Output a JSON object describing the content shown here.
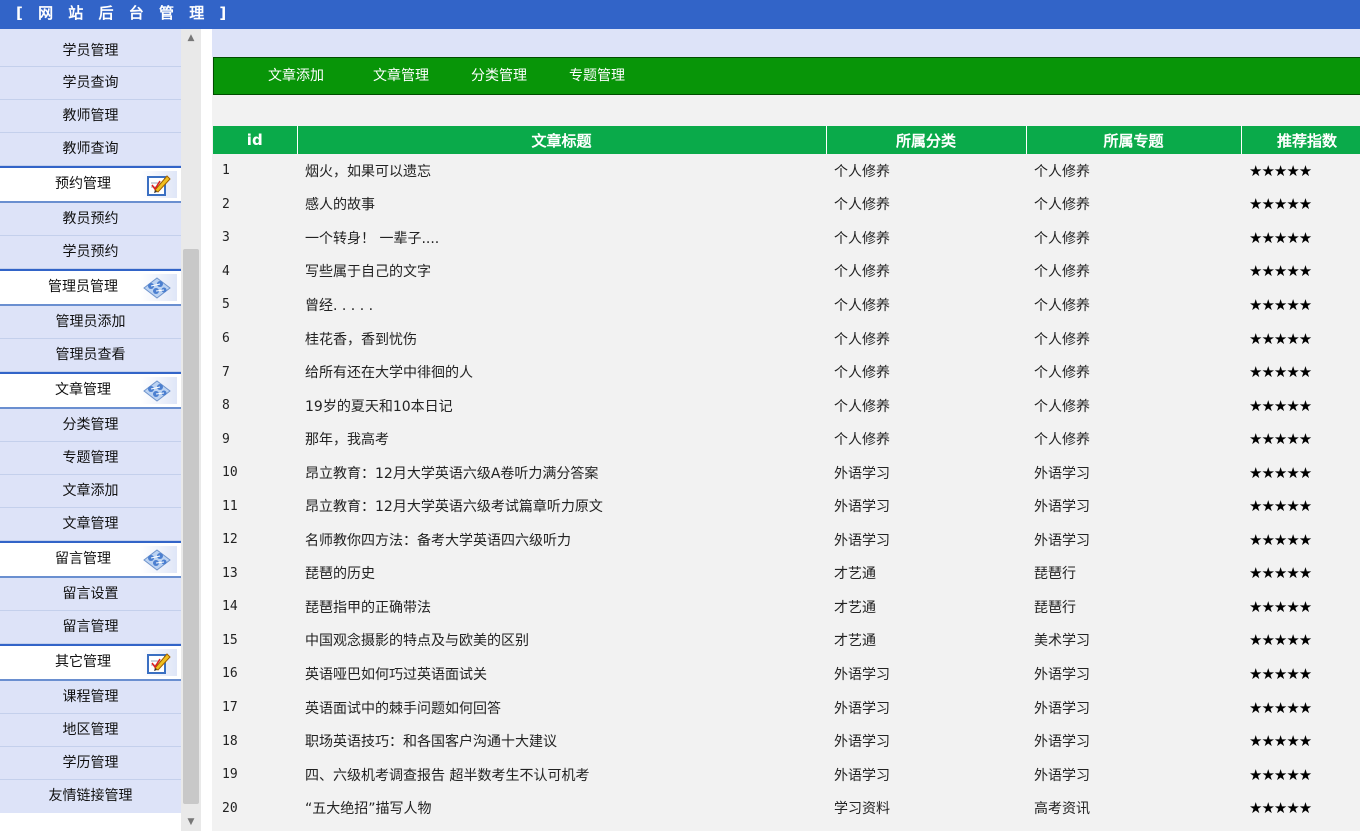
{
  "header": {
    "title": "[ 网 站 后 台 管 理 ]"
  },
  "sidebar": {
    "menu": [
      {
        "kind": "item",
        "label": "学员管理",
        "first": true
      },
      {
        "kind": "item",
        "label": "学员查询"
      },
      {
        "kind": "item",
        "label": "教师管理"
      },
      {
        "kind": "item",
        "label": "教师查询"
      },
      {
        "kind": "group",
        "label": "预约管理",
        "icon": "edit-icon"
      },
      {
        "kind": "item",
        "label": "教员预约"
      },
      {
        "kind": "item",
        "label": "学员预约"
      },
      {
        "kind": "group",
        "label": "管理员管理",
        "icon": "network-icon"
      },
      {
        "kind": "item",
        "label": "管理员添加"
      },
      {
        "kind": "item",
        "label": "管理员查看"
      },
      {
        "kind": "group",
        "label": "文章管理",
        "icon": "network-icon"
      },
      {
        "kind": "item",
        "label": "分类管理"
      },
      {
        "kind": "item",
        "label": "专题管理"
      },
      {
        "kind": "item",
        "label": "文章添加"
      },
      {
        "kind": "item",
        "label": "文章管理"
      },
      {
        "kind": "group",
        "label": "留言管理",
        "icon": "network-icon"
      },
      {
        "kind": "item",
        "label": "留言设置"
      },
      {
        "kind": "item",
        "label": "留言管理"
      },
      {
        "kind": "group",
        "label": "其它管理",
        "icon": "edit-icon"
      },
      {
        "kind": "item",
        "label": "课程管理"
      },
      {
        "kind": "item",
        "label": "地区管理"
      },
      {
        "kind": "item",
        "label": "学历管理"
      },
      {
        "kind": "item",
        "label": "友情链接管理",
        "last": true
      }
    ]
  },
  "tabs": [
    "文章添加",
    "文章管理",
    "分类管理",
    "专题管理"
  ],
  "table": {
    "columns": [
      "id",
      "文章标题",
      "所属分类",
      "所属专题",
      "推荐指数"
    ],
    "rows": [
      [
        "1",
        "烟火，如果可以遗忘",
        "个人修养",
        "个人修养",
        "★★★★★"
      ],
      [
        "2",
        "感人的故事",
        "个人修养",
        "个人修养",
        "★★★★★"
      ],
      [
        "3",
        "一个转身！ 一辈子....",
        "个人修养",
        "个人修养",
        "★★★★★"
      ],
      [
        "4",
        "写些属于自己的文字",
        "个人修养",
        "个人修养",
        "★★★★★"
      ],
      [
        "5",
        "曾经. . . . .",
        "个人修养",
        "个人修养",
        "★★★★★"
      ],
      [
        "6",
        "桂花香，香到忧伤",
        "个人修养",
        "个人修养",
        "★★★★★"
      ],
      [
        "7",
        "给所有还在大学中徘徊的人",
        "个人修养",
        "个人修养",
        "★★★★★"
      ],
      [
        "8",
        "19岁的夏天和10本日记",
        "个人修养",
        "个人修养",
        "★★★★★"
      ],
      [
        "9",
        "那年，我高考",
        "个人修养",
        "个人修养",
        "★★★★★"
      ],
      [
        "10",
        "昂立教育：12月大学英语六级A卷听力满分答案",
        "外语学习",
        "外语学习",
        "★★★★★"
      ],
      [
        "11",
        "昂立教育：12月大学英语六级考试篇章听力原文",
        "外语学习",
        "外语学习",
        "★★★★★"
      ],
      [
        "12",
        "名师教你四方法：备考大学英语四六级听力",
        "外语学习",
        "外语学习",
        "★★★★★"
      ],
      [
        "13",
        "琵琶的历史",
        "才艺通",
        "琵琶行",
        "★★★★★"
      ],
      [
        "14",
        "琵琶指甲的正确带法",
        "才艺通",
        "琵琶行",
        "★★★★★"
      ],
      [
        "15",
        "中国观念摄影的特点及与欧美的区别",
        "才艺通",
        "美术学习",
        "★★★★★"
      ],
      [
        "16",
        "英语哑巴如何巧过英语面试关",
        "外语学习",
        "外语学习",
        "★★★★★"
      ],
      [
        "17",
        "英语面试中的棘手问题如何回答",
        "外语学习",
        "外语学习",
        "★★★★★"
      ],
      [
        "18",
        "职场英语技巧：和各国客户沟通十大建议",
        "外语学习",
        "外语学习",
        "★★★★★"
      ],
      [
        "19",
        "四、六级机考调查报告 超半数考生不认可机考",
        "外语学习",
        "外语学习",
        "★★★★★"
      ],
      [
        "20",
        "“五大绝招”描写人物",
        "学习资料",
        "高考资讯",
        "★★★★★"
      ]
    ]
  },
  "colors": {
    "header_bg": "#3264c8",
    "tab_bar_bg": "#089508",
    "table_header_bg": "#0aaa4a",
    "sidebar_item_bg": "#dde3f8"
  }
}
